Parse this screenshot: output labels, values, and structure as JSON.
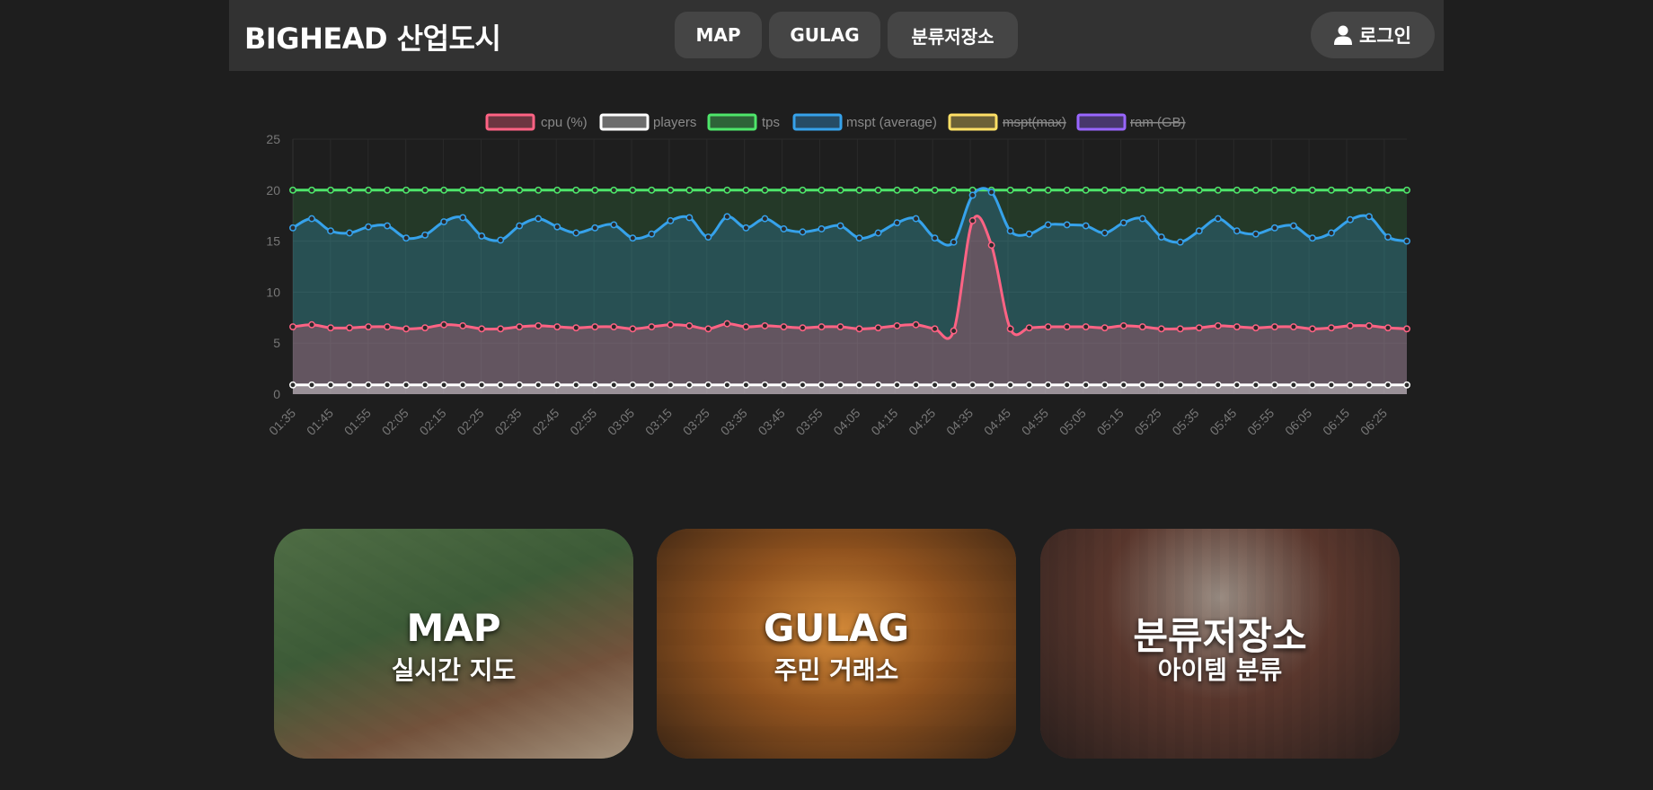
{
  "header": {
    "brand": "BIGHEAD 산업도시",
    "nav": [
      {
        "label": "MAP"
      },
      {
        "label": "GULAG"
      },
      {
        "label": "분류저장소"
      }
    ],
    "login_label": "로그인"
  },
  "chart_data": {
    "type": "line",
    "ylim": [
      0,
      25
    ],
    "yticks": [
      0,
      5,
      10,
      15,
      20,
      25
    ],
    "xticks": [
      "01:35",
      "01:45",
      "01:55",
      "02:05",
      "02:15",
      "02:25",
      "02:35",
      "02:45",
      "02:55",
      "03:05",
      "03:15",
      "03:25",
      "03:35",
      "03:45",
      "03:55",
      "04:05",
      "04:15",
      "04:25",
      "04:35",
      "04:45",
      "04:55",
      "05:05",
      "05:15",
      "05:25",
      "05:35",
      "05:45",
      "05:55",
      "06:05",
      "06:15",
      "06:25"
    ],
    "grid": true,
    "legend_position": "top",
    "series": [
      {
        "name": "cpu (%)",
        "color": "#ff6384",
        "hidden": false,
        "fill": true,
        "values": [
          6.6,
          6.8,
          6.5,
          6.5,
          6.6,
          6.6,
          6.4,
          6.5,
          6.8,
          6.7,
          6.4,
          6.4,
          6.6,
          6.7,
          6.6,
          6.5,
          6.6,
          6.6,
          6.4,
          6.6,
          6.8,
          6.7,
          6.4,
          6.9,
          6.6,
          6.7,
          6.6,
          6.5,
          6.6,
          6.6,
          6.4,
          6.5,
          6.7,
          6.8,
          6.4,
          6.2,
          17.0,
          14.6,
          6.4,
          6.5,
          6.6,
          6.6,
          6.6,
          6.5,
          6.7,
          6.6,
          6.4,
          6.4,
          6.5,
          6.7,
          6.6,
          6.5,
          6.6,
          6.6,
          6.4,
          6.5,
          6.7,
          6.7,
          6.5,
          6.4
        ]
      },
      {
        "name": "players",
        "color": "#ffffff",
        "hidden": false,
        "fill": true,
        "values": [
          0.9,
          0.9,
          0.9,
          0.9,
          0.9,
          0.9,
          0.9,
          0.9,
          0.9,
          0.9,
          0.9,
          0.9,
          0.9,
          0.9,
          0.9,
          0.9,
          0.9,
          0.9,
          0.9,
          0.9,
          0.9,
          0.9,
          0.9,
          0.9,
          0.9,
          0.9,
          0.9,
          0.9,
          0.9,
          0.9,
          0.9,
          0.9,
          0.9,
          0.9,
          0.9,
          0.9,
          0.9,
          0.9,
          0.9,
          0.9,
          0.9,
          0.9,
          0.9,
          0.9,
          0.9,
          0.9,
          0.9,
          0.9,
          0.9,
          0.9,
          0.9,
          0.9,
          0.9,
          0.9,
          0.9,
          0.9,
          0.9,
          0.9,
          0.9,
          0.9
        ]
      },
      {
        "name": "tps",
        "color": "#4ee66a",
        "hidden": false,
        "fill": true,
        "values": [
          20,
          20,
          20,
          20,
          20,
          20,
          20,
          20,
          20,
          20,
          20,
          20,
          20,
          20,
          20,
          20,
          20,
          20,
          20,
          20,
          20,
          20,
          20,
          20,
          20,
          20,
          20,
          20,
          20,
          20,
          20,
          20,
          20,
          20,
          20,
          20,
          20,
          20,
          20,
          20,
          20,
          20,
          20,
          20,
          20,
          20,
          20,
          20,
          20,
          20,
          20,
          20,
          20,
          20,
          20,
          20,
          20,
          20,
          20,
          20
        ]
      },
      {
        "name": "mspt (average)",
        "color": "#36a2eb",
        "hidden": false,
        "fill": true,
        "values": [
          16.3,
          17.2,
          16.0,
          15.8,
          16.4,
          16.5,
          15.3,
          15.6,
          16.9,
          17.3,
          15.5,
          15.1,
          16.5,
          17.2,
          16.4,
          15.8,
          16.3,
          16.6,
          15.3,
          15.7,
          17.0,
          17.3,
          15.4,
          17.4,
          16.3,
          17.2,
          16.2,
          15.9,
          16.2,
          16.5,
          15.3,
          15.8,
          16.8,
          17.2,
          15.3,
          14.9,
          19.5,
          19.8,
          16.0,
          15.7,
          16.6,
          16.6,
          16.5,
          15.8,
          16.8,
          17.2,
          15.4,
          14.9,
          16.0,
          17.2,
          16.0,
          15.7,
          16.3,
          16.5,
          15.3,
          15.8,
          17.1,
          17.4,
          15.4,
          15.0
        ]
      },
      {
        "name": "mspt(max)",
        "color": "#ffe066",
        "hidden": true,
        "values": []
      },
      {
        "name": "ram (GB)",
        "color": "#9966ff",
        "hidden": true,
        "values": []
      }
    ]
  },
  "cards": [
    {
      "title": "MAP",
      "subtitle": "실시간 지도"
    },
    {
      "title": "GULAG",
      "subtitle": "주민 거래소"
    },
    {
      "title": "분류저장소",
      "subtitle": "아이템 분류"
    }
  ]
}
